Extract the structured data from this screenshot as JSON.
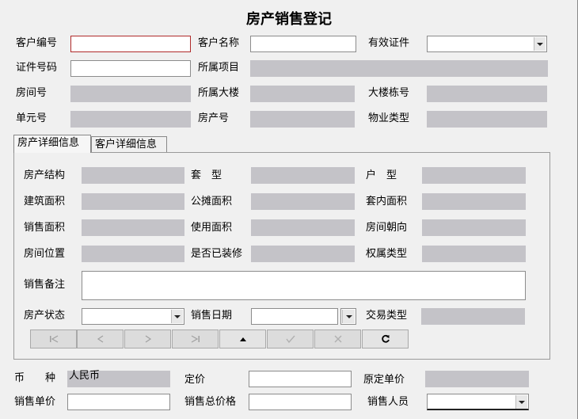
{
  "title": "房产销售登记",
  "top": {
    "customer_no": "客户编号",
    "customer_name": "客户名称",
    "valid_id": "有效证件",
    "id_no": "证件号码",
    "project": "所属项目",
    "room_no": "房间号",
    "building": "所属大楼",
    "building_no": "大楼栋号",
    "unit_no": "单元号",
    "property_no": "房产号",
    "property_type": "物业类型"
  },
  "tabs": [
    {
      "label": "房产详细信息"
    },
    {
      "label": "客户详细信息"
    }
  ],
  "detail": {
    "structure": "房产结构",
    "layout": "套　型",
    "household": "户　型",
    "built_area": "建筑面积",
    "shared_area": "公摊面积",
    "inner_area": "套内面积",
    "sale_area": "销售面积",
    "use_area": "使用面积",
    "orientation": "房间朝向",
    "position": "房间位置",
    "decorated": "是否已装修",
    "ownership": "权属类型",
    "remark": "销售备注",
    "status": "房产状态",
    "sale_date": "销售日期",
    "trade_type": "交易类型"
  },
  "nav": [
    "first",
    "prev",
    "next",
    "last",
    "insert",
    "post",
    "cancel",
    "refresh"
  ],
  "bottom": {
    "currency_label": "币　　种",
    "currency_value": "人民币",
    "price": "定价",
    "orig_unit_price": "原定单价",
    "unit_price": "销售单价",
    "total_price": "销售总价格",
    "salesperson": "销售人员"
  }
}
